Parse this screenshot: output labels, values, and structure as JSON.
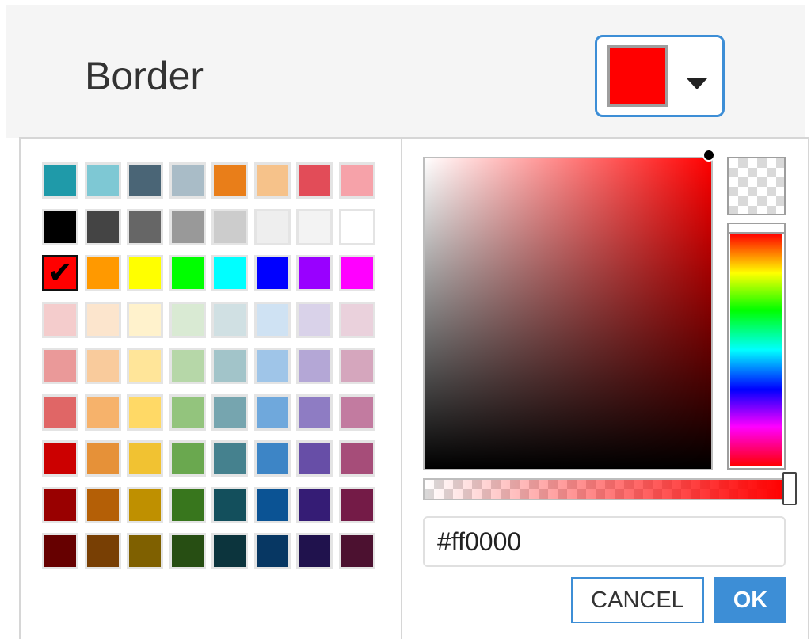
{
  "header": {
    "label": "Border",
    "selected_color": "#ff0000",
    "dropdown_icon": "caret-down-icon"
  },
  "palette": {
    "rows": [
      [
        "#1f9aa9",
        "#7ec8d4",
        "#4a6576",
        "#a9bcc7",
        "#e97e19",
        "#f6c28a",
        "#e24c58",
        "#f6a2a9"
      ],
      [
        "#000000",
        "#444444",
        "#666666",
        "#999999",
        "#cccccc",
        "#eeeeee",
        "#f3f3f3",
        "#ffffff"
      ],
      [
        "#ff0000",
        "#ff9900",
        "#ffff00",
        "#00ff00",
        "#00ffff",
        "#0000ff",
        "#9900ff",
        "#ff00ff"
      ],
      [
        "#f4cccc",
        "#fce5cd",
        "#fff2cc",
        "#d9ead3",
        "#d0e0e3",
        "#cfe2f3",
        "#d9d2e9",
        "#ead1dc"
      ],
      [
        "#ea9999",
        "#f9cb9c",
        "#ffe599",
        "#b6d7a8",
        "#a2c4c9",
        "#9fc5e8",
        "#b4a7d6",
        "#d5a6bd"
      ],
      [
        "#e06666",
        "#f6b26b",
        "#ffd966",
        "#93c47d",
        "#76a5af",
        "#6fa8dc",
        "#8e7cc3",
        "#c27ba0"
      ],
      [
        "#cc0000",
        "#e69138",
        "#f1c232",
        "#6aa84f",
        "#45818e",
        "#3d85c6",
        "#674ea7",
        "#a64d79"
      ],
      [
        "#990000",
        "#b45f06",
        "#bf9000",
        "#38761d",
        "#134f5c",
        "#0b5394",
        "#351c75",
        "#741b47"
      ],
      [
        "#660000",
        "#783f04",
        "#7f6000",
        "#274e13",
        "#0c343d",
        "#073763",
        "#20124d",
        "#4c1130"
      ]
    ],
    "selected": {
      "row": 2,
      "col": 0
    },
    "selected_icon": "checkmark-icon"
  },
  "picker": {
    "hue_color": "#ff0000",
    "hex_value": "#ff0000",
    "alpha": 1,
    "hue": 0
  },
  "buttons": {
    "cancel": "CANCEL",
    "ok": "OK"
  },
  "colors": {
    "accent": "#3d8ed6"
  }
}
